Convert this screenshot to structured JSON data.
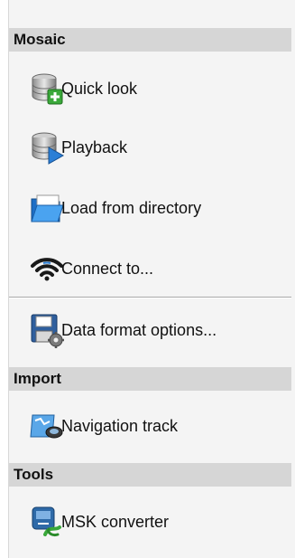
{
  "sections": {
    "mosaic": {
      "title": "Mosaic",
      "items": [
        {
          "label": "Quick look",
          "icon": "database-add-icon"
        },
        {
          "label": "Playback",
          "icon": "database-play-icon"
        },
        {
          "label": "Load from directory",
          "icon": "folder-open-icon"
        },
        {
          "label": "Connect to...",
          "icon": "wifi-icon"
        }
      ],
      "extra_items": [
        {
          "label": "Data format options...",
          "icon": "floppy-settings-icon"
        }
      ]
    },
    "import": {
      "title": "Import",
      "items": [
        {
          "label": "Navigation track",
          "icon": "navigation-track-icon"
        }
      ]
    },
    "tools": {
      "title": "Tools",
      "items": [
        {
          "label": "MSK converter",
          "icon": "msk-converter-icon"
        }
      ]
    }
  },
  "colors": {
    "header_bg": "#d6d6d6",
    "panel_bg": "#f4f4f4",
    "accent_blue": "#2b7fd6",
    "accent_green": "#3aa83a"
  }
}
